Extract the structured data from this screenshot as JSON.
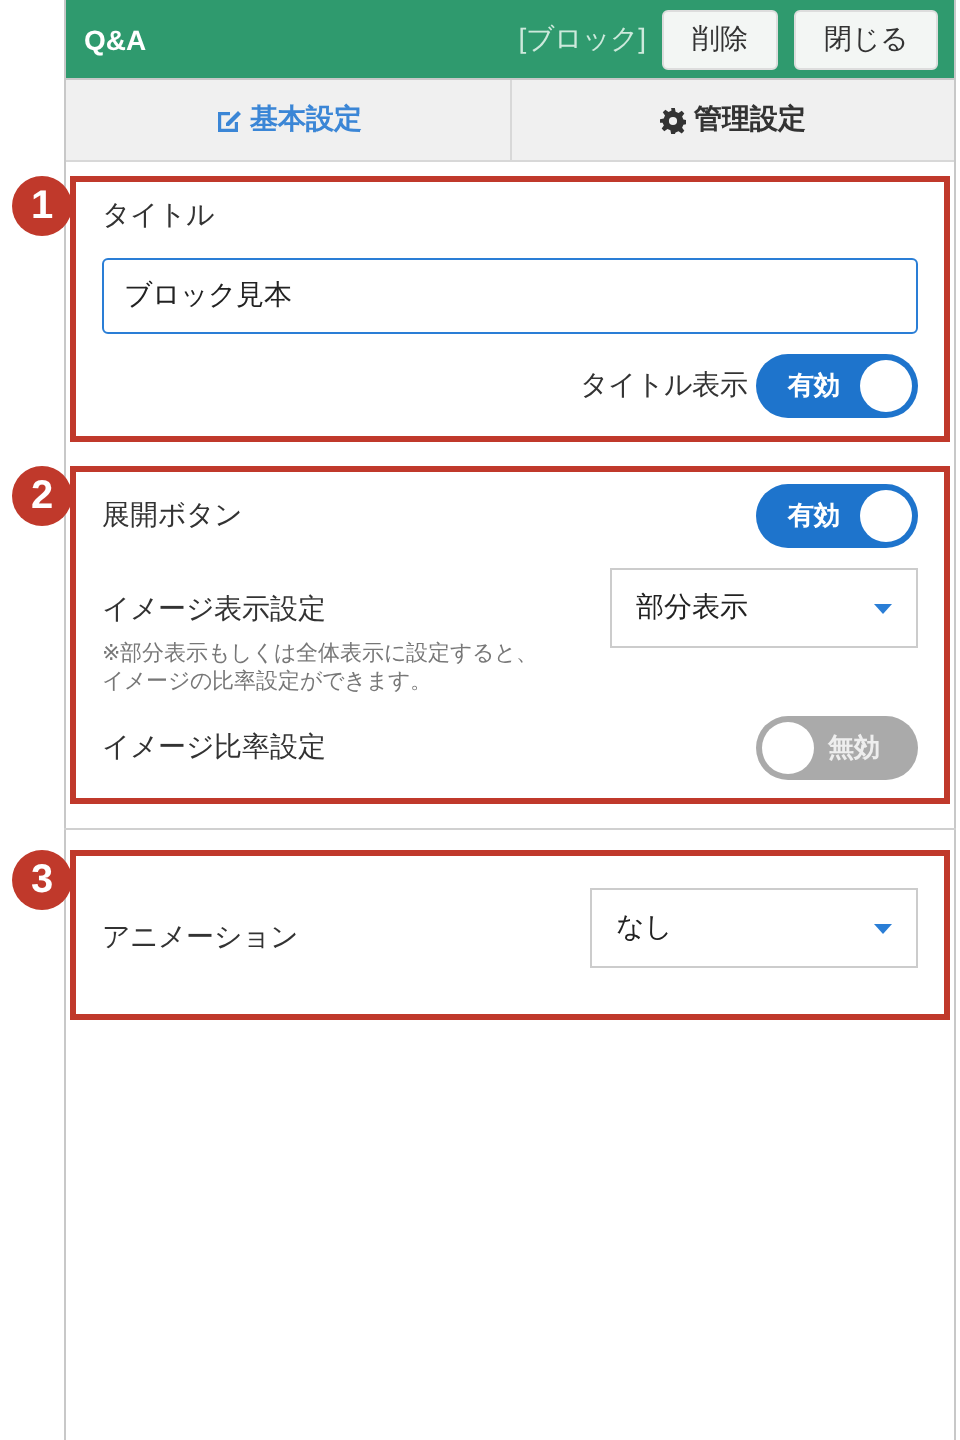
{
  "header": {
    "title": "Q&A",
    "tag": "[ブロック]",
    "buttons": [
      "削除",
      "閉じる"
    ]
  },
  "tabs": [
    {
      "label": "基本設定",
      "selected": true
    },
    {
      "label": "管理設定",
      "selected": false
    }
  ],
  "sections": [
    {
      "badge": "1",
      "divider_above": false,
      "items": [
        {
          "kind": "label",
          "label": "タイトル"
        },
        {
          "kind": "input",
          "value": "ブロック見本",
          "focused": true
        },
        {
          "kind": "inline-toggle",
          "label": "タイトル表示",
          "on": true,
          "state_text": "有効"
        }
      ]
    },
    {
      "badge": "2",
      "divider_above": false,
      "items": [
        {
          "kind": "toggle",
          "label": "展開ボタン",
          "on": true,
          "state_text": "有効"
        },
        {
          "kind": "select",
          "label": "イメージ表示設定",
          "value": "部分表示",
          "note": "※部分表示もしくは全体表示に設定すると、イメージの比率設定ができます。"
        },
        {
          "kind": "toggle",
          "label": "イメージ比率設定",
          "on": false,
          "state_text": "無効"
        }
      ]
    },
    {
      "badge": "3",
      "divider_above": true,
      "items": [
        {
          "kind": "select",
          "label": "アニメーション",
          "value": "なし"
        }
      ]
    }
  ]
}
